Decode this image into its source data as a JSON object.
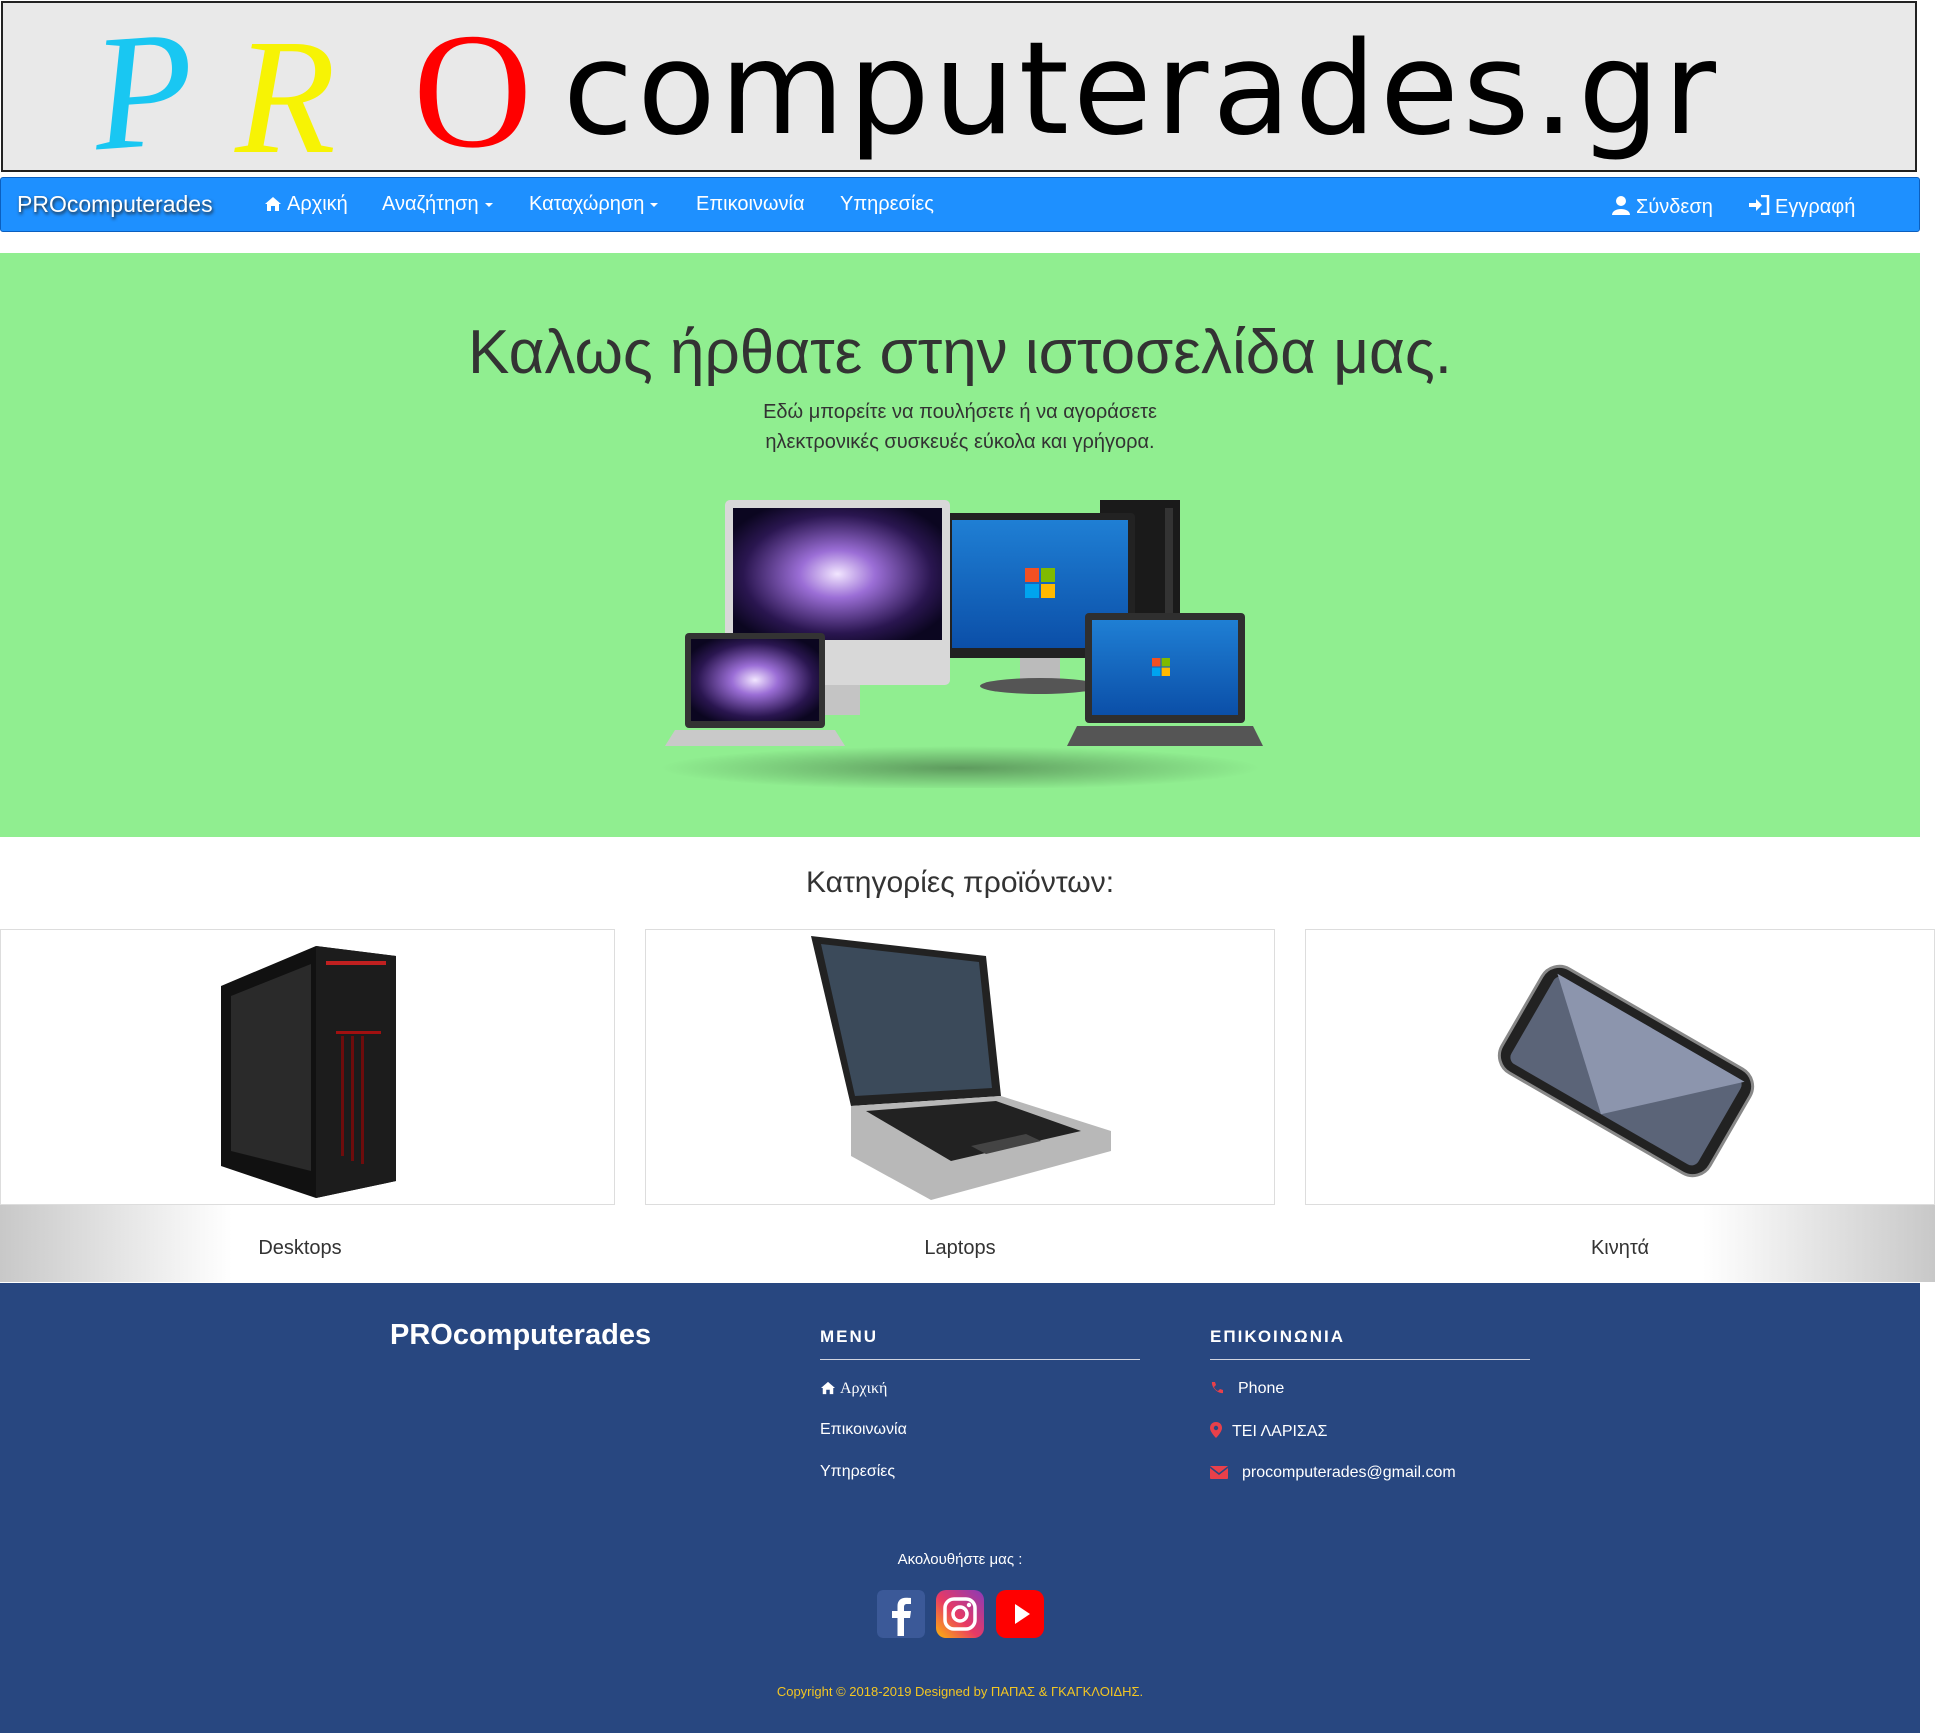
{
  "banner": {
    "logo_p": "P",
    "logo_r": "R",
    "logo_o": "O",
    "logo_rest": "computerades.gr"
  },
  "navbar": {
    "brand": "PROcomputerades",
    "items": [
      {
        "label": "Αρχική",
        "icon": "home-icon"
      },
      {
        "label": "Αναζήτηση",
        "dropdown": true
      },
      {
        "label": "Καταχώρηση",
        "dropdown": true
      },
      {
        "label": "Επικοινωνία"
      },
      {
        "label": "Υπηρεσίες"
      }
    ],
    "login": {
      "label": "Σύνδεση",
      "icon": "user-icon"
    },
    "register": {
      "label": "Εγγραφή",
      "icon": "sign-in-icon"
    }
  },
  "hero": {
    "title": "Καλως ήρθατε στην ιστοσελίδα μας.",
    "line1": "Εδώ μπορείτε να πουλήσετε ή να αγοράσετε",
    "line2": "ηλεκτρονικές συσκευές εύκολα και γρήγορα."
  },
  "categories": {
    "heading": "Κατηγορίες προϊόντων:",
    "items": [
      {
        "label": "Desktops"
      },
      {
        "label": "Laptops"
      },
      {
        "label": "Κινητά"
      }
    ]
  },
  "footer": {
    "brand": "PROcomputerades",
    "menu_heading": "MENU",
    "menu_links": [
      {
        "label": "Αρχική",
        "icon": "home-icon"
      },
      {
        "label": "Επικοινωνία"
      },
      {
        "label": "Υπηρεσίες"
      }
    ],
    "contact_heading": "ΕΠΙΚΟΙΝΩΝΙΑ",
    "contact": {
      "phone": "Phone",
      "location": "ΤΕΙ ΛΑΡΙΣΑΣ",
      "email": "procomputerades@gmail.com"
    },
    "follow": "Ακολουθήστε μας :",
    "social": [
      "facebook-icon",
      "instagram-icon",
      "youtube-icon"
    ],
    "copyright": "Copyright © 2018-2019 Designed by ΠΑΠΑΣ & ΓΚΑΓΚΛΟΙΔΗΣ."
  },
  "colors": {
    "navbar": "#1e90ff",
    "hero_bg": "#90ee90",
    "footer_bg": "#284780",
    "copyright": "#f3c623",
    "contact_icons": "#e8404a"
  }
}
